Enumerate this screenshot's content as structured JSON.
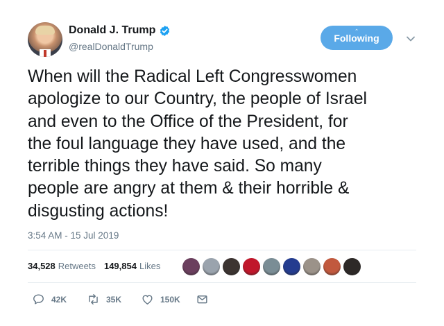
{
  "user": {
    "display_name": "Donald J. Trump",
    "handle": "@realDonaldTrump",
    "verified": true
  },
  "follow_button": {
    "label": "Following",
    "hint": "⌃"
  },
  "tweet": {
    "text": "When will the Radical Left Congresswomen\napologize to our Country, the people of Israel\nand even to the Office of the President, for\nthe foul language they have used, and the\nterrible things they have said. So many\npeople are angry at them & their horrible &\ndisgusting actions!",
    "timestamp": "3:54 AM - 15 Jul 2019"
  },
  "stats": {
    "retweets_count": "34,528",
    "retweets_label": "Retweets",
    "likes_count": "149,854",
    "likes_label": "Likes"
  },
  "liker_avatar_colors": [
    "#6b3f5e",
    "#9aa3ad",
    "#3c3431",
    "#c0172b",
    "#7a8d95",
    "#243c8f",
    "#9b9289",
    "#c1593e",
    "#2d2927"
  ],
  "actions": {
    "reply_count": "42K",
    "retweet_count": "35K",
    "like_count": "150K"
  },
  "colors": {
    "accent": "#5aa9e8",
    "verified": "#1da1f2",
    "secondary_text": "#657786"
  }
}
